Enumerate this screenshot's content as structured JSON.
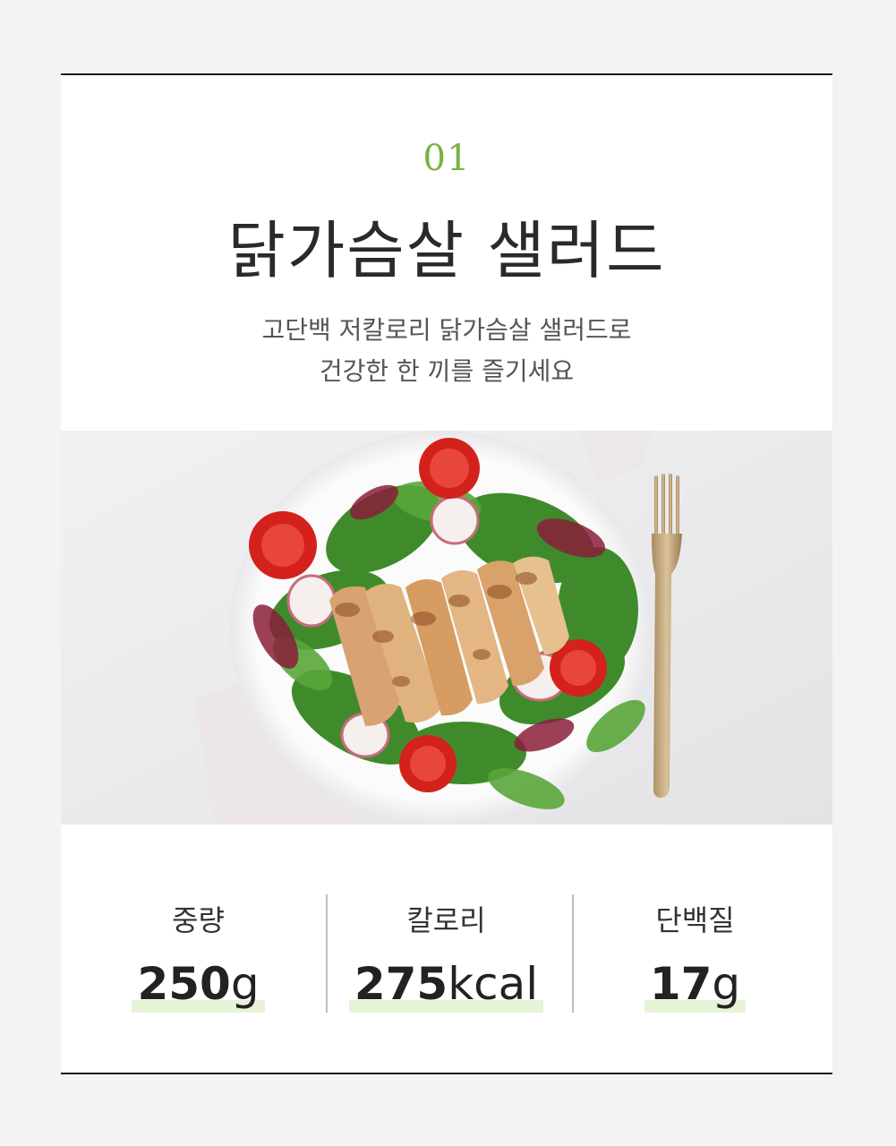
{
  "header": {
    "number": "01",
    "title": "닭가슴살 샐러드",
    "subtitle_line1": "고단백 저칼로리 닭가슴살 샐러드로",
    "subtitle_line2": "건강한 한 끼를 즐기세요"
  },
  "image": {
    "subject": "grilled chicken breast salad on white plate with fork"
  },
  "stats": [
    {
      "label": "중량",
      "value": "250",
      "unit": "g"
    },
    {
      "label": "칼로리",
      "value": "275",
      "unit": "kcal"
    },
    {
      "label": "단백질",
      "value": "17",
      "unit": "g"
    }
  ],
  "colors": {
    "accent": "#7ab241",
    "highlight": "#e6f3d6",
    "border": "#1a1a1a"
  }
}
